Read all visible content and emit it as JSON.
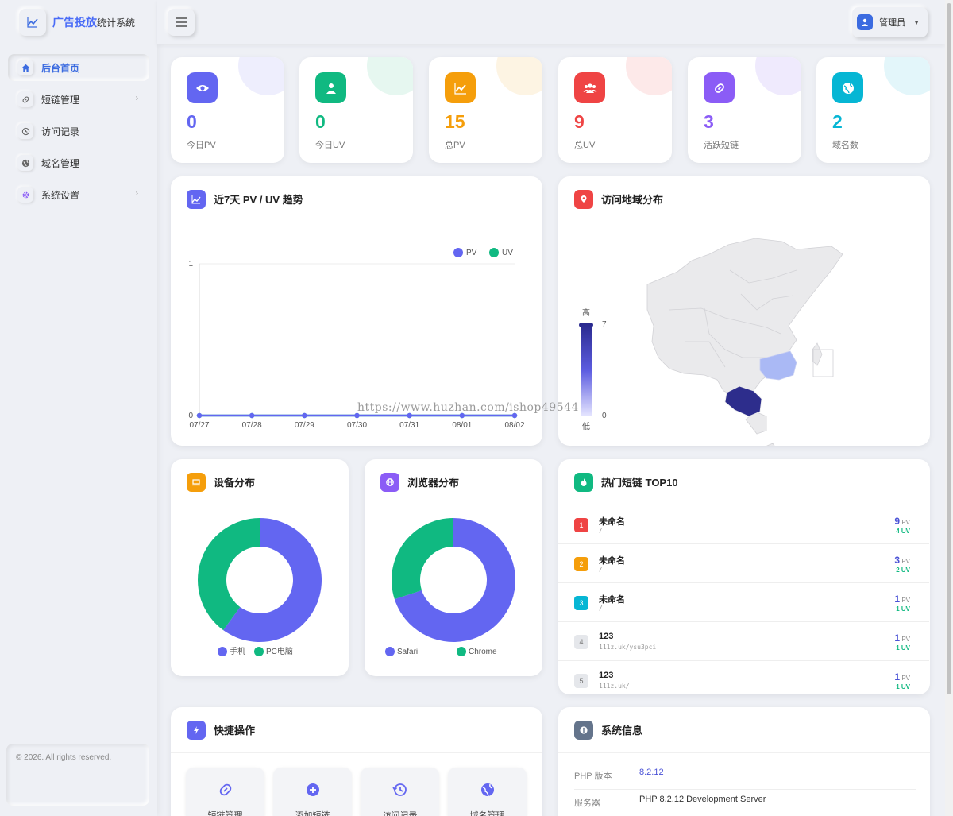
{
  "app": {
    "logo_main": "广告投放",
    "logo_sub": "统计系统"
  },
  "sidebar": {
    "items": [
      {
        "label": "后台首页",
        "icon": "home-icon"
      },
      {
        "label": "短链管理",
        "icon": "link-icon"
      },
      {
        "label": "访问记录",
        "icon": "history-icon"
      },
      {
        "label": "域名管理",
        "icon": "globe-icon"
      },
      {
        "label": "系统设置",
        "icon": "gear-icon"
      }
    ],
    "copyright": "© 2026. All rights reserved."
  },
  "header": {
    "user_label": "管理员"
  },
  "stats": [
    {
      "value": "0",
      "label": "今日PV",
      "color": "#6366f1",
      "tint": "#eeeefd",
      "icon": "eye-icon"
    },
    {
      "value": "0",
      "label": "今日UV",
      "color": "#10b981",
      "tint": "#e6f7f0",
      "icon": "user-icon"
    },
    {
      "value": "15",
      "label": "总PV",
      "color": "#f59e0b",
      "tint": "#fdf4e3",
      "icon": "chart-icon"
    },
    {
      "value": "9",
      "label": "总UV",
      "color": "#ef4444",
      "tint": "#fde9e9",
      "icon": "users-icon"
    },
    {
      "value": "3",
      "label": "活跃短链",
      "color": "#8b5cf6",
      "tint": "#efeafd",
      "icon": "link-icon"
    },
    {
      "value": "2",
      "label": "域名数",
      "color": "#06b6d4",
      "tint": "#e3f6fa",
      "icon": "globe-icon"
    }
  ],
  "trend": {
    "title": "近7天 PV / UV 趋势",
    "legend_pv": "PV",
    "legend_uv": "UV"
  },
  "geo": {
    "title": "访问地域分布",
    "scale_high": "高",
    "scale_low": "低",
    "scale_max": "7",
    "scale_min": "0"
  },
  "device": {
    "title": "设备分布",
    "legend": [
      "手机",
      "PC电脑"
    ]
  },
  "browser": {
    "title": "浏览器分布",
    "legend": [
      "Safari",
      "Chrome"
    ]
  },
  "top_links": {
    "title": "热门短链 TOP10",
    "pv_unit": "PV",
    "uv_unit": "UV",
    "rows": [
      {
        "rank": "1",
        "title": "未命名",
        "url": "/",
        "pv": "9",
        "uv": "4"
      },
      {
        "rank": "2",
        "title": "未命名",
        "url": "/",
        "pv": "3",
        "uv": "2"
      },
      {
        "rank": "3",
        "title": "未命名",
        "url": "/",
        "pv": "1",
        "uv": "1"
      },
      {
        "rank": "4",
        "title": "123",
        "url": "111z.uk/ysu3pci",
        "pv": "1",
        "uv": "1"
      },
      {
        "rank": "5",
        "title": "123",
        "url": "111z.uk/",
        "pv": "1",
        "uv": "1"
      }
    ]
  },
  "quick": {
    "title": "快捷操作",
    "buttons": [
      "短链管理",
      "添加短链",
      "访问记录",
      "域名管理"
    ]
  },
  "sysinfo": {
    "title": "系统信息",
    "rows": [
      {
        "key": "PHP 版本",
        "value": "8.2.12"
      },
      {
        "key": "服务器",
        "value": "PHP 8.2.12 Development Server"
      }
    ]
  },
  "watermark": "https://www.huzhan.com/ishop49544",
  "chart_data": [
    {
      "type": "line",
      "title": "近7天 PV / UV 趋势",
      "categories": [
        "07/27",
        "07/28",
        "07/29",
        "07/30",
        "07/31",
        "08/01",
        "08/02"
      ],
      "series": [
        {
          "name": "PV",
          "values": [
            0,
            0,
            0,
            0,
            0,
            0,
            0
          ]
        },
        {
          "name": "UV",
          "values": [
            0,
            0,
            0,
            0,
            0,
            0,
            0
          ]
        }
      ],
      "ylim": [
        0,
        1
      ],
      "yticks": [
        "0",
        "1"
      ],
      "legend": "top-right"
    },
    {
      "type": "pie",
      "title": "设备分布",
      "labels": [
        "手机",
        "PC电脑"
      ],
      "values": [
        6,
        4
      ],
      "colors": [
        "#6366f1",
        "#10b981"
      ]
    },
    {
      "type": "pie",
      "title": "浏览器分布",
      "labels": [
        "Safari",
        "Chrome"
      ],
      "values": [
        7,
        3
      ],
      "colors": [
        "#6366f1",
        "#10b981"
      ]
    }
  ]
}
